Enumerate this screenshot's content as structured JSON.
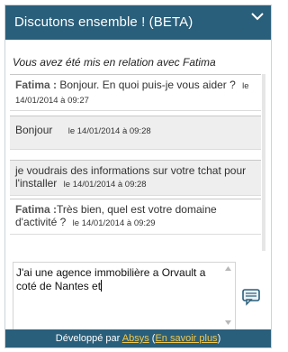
{
  "header": {
    "title": "Discutons ensemble ! (BETA)"
  },
  "notice": "Vous avez été mis en relation avec Fatima",
  "messages": [
    {
      "author": "Fatima :",
      "text": " Bonjour. En quoi puis-je vous aider ?",
      "timestamp": "le 14/01/2014 à 09:27"
    },
    {
      "author": "",
      "text": "Bonjour",
      "timestamp": "le 14/01/2014 à 09:28"
    },
    {
      "author": "",
      "text": "je voudrais des informations sur votre tchat pour l'installer",
      "timestamp": "le 14/01/2014 à 09:28"
    },
    {
      "author": "Fatima :",
      "text": "Très bien, quel est votre domaine d'activité ?",
      "timestamp": "le 14/01/2014 à 09:29"
    }
  ],
  "input": {
    "value": "J'ai une agence immobilière a Orvault a coté de Nantes et"
  },
  "footer": {
    "prefix": "Développé par ",
    "link1": "Absys",
    "middle": " (",
    "link2": "En savoir plus",
    "suffix": ")"
  },
  "colors": {
    "header_bg": "#2a5f7b",
    "footer_link": "#f2c94c",
    "message_bg": "#eeeeee"
  },
  "icons": {
    "collapse": "chevron-down-icon",
    "send": "chat-bubble-icon",
    "scroll_up": "triangle-up-icon",
    "scroll_down": "triangle-down-icon"
  }
}
